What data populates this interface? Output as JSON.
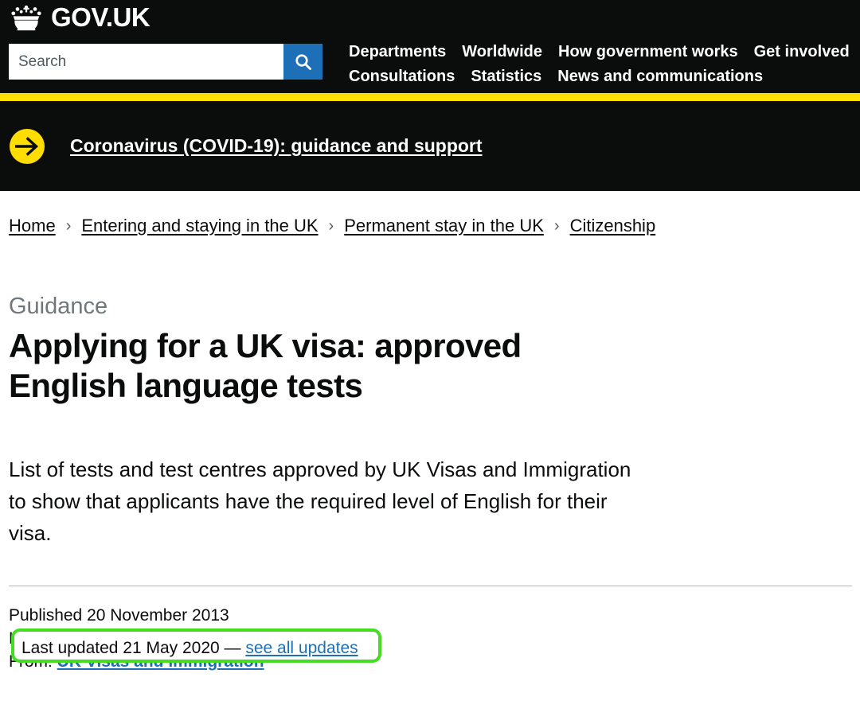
{
  "header": {
    "brand": "GOV.UK",
    "crown_icon": "crown-logo",
    "search": {
      "placeholder": "Search",
      "value": "",
      "button_icon": "search-icon",
      "button_color": "#1d70b8"
    },
    "nav_items": [
      {
        "label": "Departments"
      },
      {
        "label": "Worldwide"
      },
      {
        "label": "How government works"
      },
      {
        "label": "Get involved"
      },
      {
        "label": "Consultations"
      },
      {
        "label": "Statistics"
      },
      {
        "label": "News and communications"
      }
    ],
    "accent_bar_color": "#ffdd00",
    "background_color": "#0b0c0c"
  },
  "covid_banner": {
    "icon": "arrow-right-circle-icon",
    "link_text": "Coronavirus (COVID-19): guidance and support",
    "icon_color": "#ffdd00"
  },
  "breadcrumbs": {
    "separator": "›",
    "items": [
      {
        "label": "Home"
      },
      {
        "label": "Entering and staying in the UK"
      },
      {
        "label": "Permanent stay in the UK"
      },
      {
        "label": "Citizenship"
      }
    ]
  },
  "main": {
    "kicker": "Guidance",
    "title": "Applying for a UK visa: approved English language tests",
    "lede": "List of tests and test centres approved by UK Visas and Immigration to show that applicants have the required level of English for their visa."
  },
  "metadata": {
    "published_line": "Published 20 November 2013",
    "last_updated_prefix": "Last updated 21 May 2020 — ",
    "see_all_updates_label": "see all updates",
    "from_label": "From:",
    "from_organisation": "UK Visas and Immigration"
  },
  "annotation": {
    "highlight_color": "#44dd22",
    "target_text_prefix": "Last updated 21 May 2020 — ",
    "target_link_label": "see all updates"
  }
}
